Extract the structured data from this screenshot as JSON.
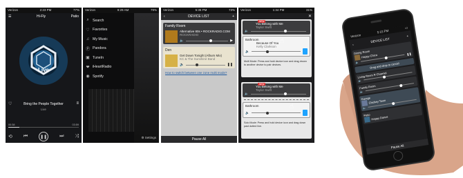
{
  "colors": {
    "accent_blue": "#1ea3ff",
    "panel_dark": "#3a3a3c",
    "highlight": "#e9e3cf",
    "badge_red": "#d33333"
  },
  "phone1": {
    "status_left": "Verizon",
    "status_time": "2:23 PM",
    "status_right": "77%",
    "title": "Hi-Fly",
    "right_btn": "Patio",
    "art_text": "Live",
    "song": "Bring the People Together",
    "artist": "Live",
    "time_elapsed": "00:38",
    "time_total": "03:59",
    "progress": 0.16
  },
  "phone2": {
    "status_left": "Verizon",
    "status_time": "9:29 AM",
    "status_right": "79%",
    "menu": [
      {
        "icon": "search-icon",
        "label": "Search"
      },
      {
        "icon": "heart-icon",
        "label": "Favorites"
      },
      {
        "icon": "music-icon",
        "label": "My Music"
      },
      {
        "icon": "pandora-icon",
        "label": "Pandora"
      },
      {
        "icon": "tunein-icon",
        "label": "TuneIn"
      },
      {
        "icon": "iheartradio-icon",
        "label": "iHeartRadio"
      },
      {
        "icon": "spotify-icon",
        "label": "Spotify"
      }
    ],
    "settings": "Settings"
  },
  "phone3": {
    "status_left": "Verizon",
    "status_time": "5:35 PM",
    "status_right": "73%",
    "title": "DEVICE LIST",
    "groups": [
      {
        "room": "Family Room",
        "track": "Alternative 80s • ROCKRADIO.COM",
        "sub": "ROCKRADIO",
        "volume": 0.55
      },
      {
        "room": "Den",
        "track": "Get Down Tonight (Album Mix)",
        "sub": "KC & The Sunshine Band",
        "volume": 0.25
      }
    ],
    "link": "How to switch between one zone multi mode?",
    "pause": "Pause All"
  },
  "phone4": {
    "status_left": "Verizon",
    "status_time": "1:34 PM",
    "status_right": "31%",
    "panel1": {
      "badge": "NEW",
      "track1": "You Belong with Me",
      "track1_sub": "Taylor Swift",
      "room": "Bathroom",
      "track2": "Because Of You",
      "track2_sub": "Kelly Clarkson",
      "hint": "Multi Mode: Press and hold device icon and drag drown to another device to pair devices."
    },
    "panel2": {
      "badge": "NEW",
      "track1": "You Belong with Me",
      "track1_sub": "Taylor Swift",
      "room": "Bathroom",
      "hint": "Solo Mode: Press and hold device icon and drag down past dotted line."
    }
  },
  "big_phone": {
    "status_left": "Verizon",
    "status_time": "5:15 PM",
    "title": "DEVICE LIST",
    "rooms": [
      {
        "room": "Dining Room",
        "track": "Happy Chica",
        "sub": "Happy Chica"
      },
      {
        "room": "Living Room R Channel",
        "track": "",
        "sub": ""
      },
      {
        "room": "Family Room",
        "track": "",
        "sub": ""
      },
      {
        "room": "Garage",
        "track": "Chickey Town",
        "sub": ""
      },
      {
        "room": "Patio",
        "track": "Happy Dance",
        "sub": ""
      }
    ],
    "drag_text": "Drag and drop to cancel",
    "pause": "Pause All"
  }
}
